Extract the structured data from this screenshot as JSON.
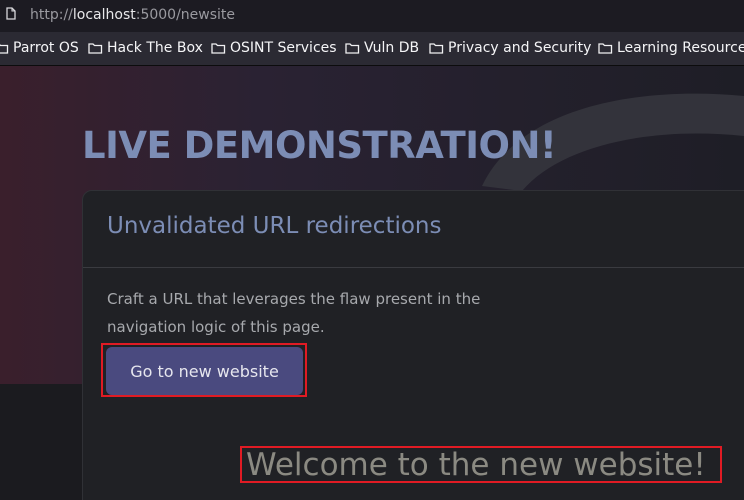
{
  "browser": {
    "url_prefix": "http://",
    "url_host": "localhost",
    "url_path": ":5000/newsite",
    "bookmarks": [
      {
        "label": "Parrot OS",
        "icon": "folder-icon"
      },
      {
        "label": "Hack The Box",
        "icon": "folder-icon"
      },
      {
        "label": "OSINT Services",
        "icon": "folder-icon"
      },
      {
        "label": "Vuln DB",
        "icon": "folder-icon"
      },
      {
        "label": "Privacy and Security",
        "icon": "folder-icon"
      },
      {
        "label": "Learning Resources",
        "icon": "folder-icon"
      }
    ]
  },
  "page": {
    "heading": "LIVE DEMONSTRATION!",
    "card": {
      "title": "Unvalidated URL redirections",
      "description": "Craft a URL that leverages the flaw present in the navigation logic of this page.",
      "button_label": "Go to new website"
    },
    "welcome_message": "Welcome to the new website!"
  },
  "colors": {
    "accent": "#7c8db5",
    "button": "#4a4a7f",
    "highlight_box": "#e01b24"
  }
}
